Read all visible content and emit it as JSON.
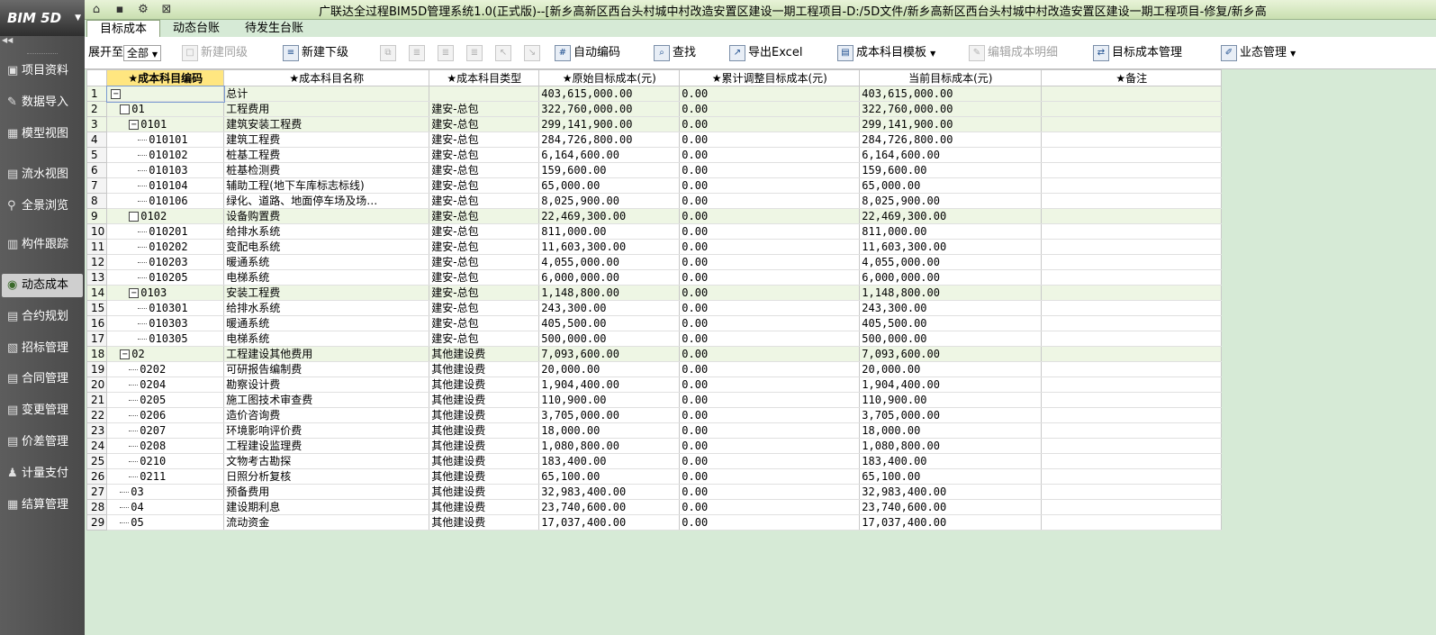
{
  "app": {
    "logo": "BIM 5D",
    "title": "广联达全过程BIM5D管理系统1.0(正式版)--[新乡高新区西台头村城中村改造安置区建设一期工程项目-D:/5D文件/新乡高新区西台头村城中村改造安置区建设一期工程项目-修复/新乡高"
  },
  "tabs": [
    {
      "label": "目标成本",
      "active": true
    },
    {
      "label": "动态台账",
      "active": false
    },
    {
      "label": "待发生台账",
      "active": false
    }
  ],
  "sidebar": {
    "items": [
      {
        "icon": "folder-icon",
        "label": "项目资料"
      },
      {
        "icon": "import-icon",
        "label": "数据导入"
      },
      {
        "icon": "model-icon",
        "label": "模型视图"
      },
      {
        "icon": "flow-icon",
        "label": "流水视图"
      },
      {
        "icon": "panorama-icon",
        "label": "全景浏览"
      },
      {
        "icon": "tracking-icon",
        "label": "构件跟踪"
      },
      {
        "icon": "cost-icon",
        "label": "动态成本",
        "active": true
      },
      {
        "icon": "contract-plan-icon",
        "label": "合约规划"
      },
      {
        "icon": "bid-icon",
        "label": "招标管理"
      },
      {
        "icon": "contract-icon",
        "label": "合同管理"
      },
      {
        "icon": "change-icon",
        "label": "变更管理"
      },
      {
        "icon": "price-diff-icon",
        "label": "价差管理"
      },
      {
        "icon": "payment-icon",
        "label": "计量支付"
      },
      {
        "icon": "settlement-icon",
        "label": "结算管理"
      }
    ]
  },
  "toolbar": {
    "expand_label": "展开至",
    "expand_value": "全部",
    "new_same": "新建同级",
    "new_child": "新建下级",
    "auto_code": "自动编码",
    "find": "查找",
    "export_excel": "导出Excel",
    "subject_template": "成本科目模板",
    "edit_detail": "编辑成本明细",
    "target_manage": "目标成本管理",
    "business_manage": "业态管理"
  },
  "grid": {
    "headers": [
      "★成本科目编码",
      "★成本科目名称",
      "★成本科目类型",
      "★原始目标成本(元)",
      "★累计调整目标成本(元)",
      "当前目标成本(元)",
      "★备注"
    ],
    "rows": [
      {
        "n": "1",
        "code": "",
        "name": "总计",
        "type": "",
        "orig": "403,615,000.00",
        "adj": "0.00",
        "cur": "403,615,000.00",
        "lvl": 0,
        "box": "−",
        "grp": true
      },
      {
        "n": "2",
        "code": "01",
        "name": "工程费用",
        "type": "建安-总包",
        "orig": "322,760,000.00",
        "adj": "0.00",
        "cur": "322,760,000.00",
        "lvl": 1,
        "box": " ",
        "grp": true
      },
      {
        "n": "3",
        "code": "0101",
        "name": "建筑安装工程费",
        "type": "建安-总包",
        "orig": "299,141,900.00",
        "adj": "0.00",
        "cur": "299,141,900.00",
        "lvl": 2,
        "box": "−",
        "grp": true
      },
      {
        "n": "4",
        "code": "010101",
        "name": "建筑工程费",
        "type": "建安-总包",
        "orig": "284,726,800.00",
        "adj": "0.00",
        "cur": "284,726,800.00",
        "lvl": 3
      },
      {
        "n": "5",
        "code": "010102",
        "name": "桩基工程费",
        "type": "建安-总包",
        "orig": "6,164,600.00",
        "adj": "0.00",
        "cur": "6,164,600.00",
        "lvl": 3
      },
      {
        "n": "6",
        "code": "010103",
        "name": "桩基检测费",
        "type": "建安-总包",
        "orig": "159,600.00",
        "adj": "0.00",
        "cur": "159,600.00",
        "lvl": 3
      },
      {
        "n": "7",
        "code": "010104",
        "name": "辅助工程(地下车库标志标线)",
        "type": "建安-总包",
        "orig": "65,000.00",
        "adj": "0.00",
        "cur": "65,000.00",
        "lvl": 3
      },
      {
        "n": "8",
        "code": "010106",
        "name": "绿化、道路、地面停车场及场…",
        "type": "建安-总包",
        "orig": "8,025,900.00",
        "adj": "0.00",
        "cur": "8,025,900.00",
        "lvl": 3
      },
      {
        "n": "9",
        "code": "0102",
        "name": "设备购置费",
        "type": "建安-总包",
        "orig": "22,469,300.00",
        "adj": "0.00",
        "cur": "22,469,300.00",
        "lvl": 2,
        "box": " ",
        "grp": true
      },
      {
        "n": "10",
        "code": "010201",
        "name": "给排水系统",
        "type": "建安-总包",
        "orig": "811,000.00",
        "adj": "0.00",
        "cur": "811,000.00",
        "lvl": 3
      },
      {
        "n": "11",
        "code": "010202",
        "name": "变配电系统",
        "type": "建安-总包",
        "orig": "11,603,300.00",
        "adj": "0.00",
        "cur": "11,603,300.00",
        "lvl": 3
      },
      {
        "n": "12",
        "code": "010203",
        "name": "暖通系统",
        "type": "建安-总包",
        "orig": "4,055,000.00",
        "adj": "0.00",
        "cur": "4,055,000.00",
        "lvl": 3
      },
      {
        "n": "13",
        "code": "010205",
        "name": "电梯系统",
        "type": "建安-总包",
        "orig": "6,000,000.00",
        "adj": "0.00",
        "cur": "6,000,000.00",
        "lvl": 3
      },
      {
        "n": "14",
        "code": "0103",
        "name": "安装工程费",
        "type": "建安-总包",
        "orig": "1,148,800.00",
        "adj": "0.00",
        "cur": "1,148,800.00",
        "lvl": 2,
        "box": "−",
        "grp": true
      },
      {
        "n": "15",
        "code": "010301",
        "name": "给排水系统",
        "type": "建安-总包",
        "orig": "243,300.00",
        "adj": "0.00",
        "cur": "243,300.00",
        "lvl": 3
      },
      {
        "n": "16",
        "code": "010303",
        "name": "暖通系统",
        "type": "建安-总包",
        "orig": "405,500.00",
        "adj": "0.00",
        "cur": "405,500.00",
        "lvl": 3
      },
      {
        "n": "17",
        "code": "010305",
        "name": "电梯系统",
        "type": "建安-总包",
        "orig": "500,000.00",
        "adj": "0.00",
        "cur": "500,000.00",
        "lvl": 3
      },
      {
        "n": "18",
        "code": "02",
        "name": "工程建设其他费用",
        "type": "其他建设费",
        "orig": "7,093,600.00",
        "adj": "0.00",
        "cur": "7,093,600.00",
        "lvl": 1,
        "box": "−",
        "grp": true
      },
      {
        "n": "19",
        "code": "0202",
        "name": "可研报告编制费",
        "type": "其他建设费",
        "orig": "20,000.00",
        "adj": "0.00",
        "cur": "20,000.00",
        "lvl": 2
      },
      {
        "n": "20",
        "code": "0204",
        "name": "勘察设计费",
        "type": "其他建设费",
        "orig": "1,904,400.00",
        "adj": "0.00",
        "cur": "1,904,400.00",
        "lvl": 2
      },
      {
        "n": "21",
        "code": "0205",
        "name": "施工图技术审查费",
        "type": "其他建设费",
        "orig": "110,900.00",
        "adj": "0.00",
        "cur": "110,900.00",
        "lvl": 2
      },
      {
        "n": "22",
        "code": "0206",
        "name": "造价咨询费",
        "type": "其他建设费",
        "orig": "3,705,000.00",
        "adj": "0.00",
        "cur": "3,705,000.00",
        "lvl": 2
      },
      {
        "n": "23",
        "code": "0207",
        "name": "环境影响评价费",
        "type": "其他建设费",
        "orig": "18,000.00",
        "adj": "0.00",
        "cur": "18,000.00",
        "lvl": 2
      },
      {
        "n": "24",
        "code": "0208",
        "name": "工程建设监理费",
        "type": "其他建设费",
        "orig": "1,080,800.00",
        "adj": "0.00",
        "cur": "1,080,800.00",
        "lvl": 2
      },
      {
        "n": "25",
        "code": "0210",
        "name": "文物考古勘探",
        "type": "其他建设费",
        "orig": "183,400.00",
        "adj": "0.00",
        "cur": "183,400.00",
        "lvl": 2
      },
      {
        "n": "26",
        "code": "0211",
        "name": "日照分析复核",
        "type": "其他建设费",
        "orig": "65,100.00",
        "adj": "0.00",
        "cur": "65,100.00",
        "lvl": 2
      },
      {
        "n": "27",
        "code": "03",
        "name": "预备费用",
        "type": "其他建设费",
        "orig": "32,983,400.00",
        "adj": "0.00",
        "cur": "32,983,400.00",
        "lvl": 1
      },
      {
        "n": "28",
        "code": "04",
        "name": "建设期利息",
        "type": "其他建设费",
        "orig": "23,740,600.00",
        "adj": "0.00",
        "cur": "23,740,600.00",
        "lvl": 1
      },
      {
        "n": "29",
        "code": "05",
        "name": "流动资金",
        "type": "其他建设费",
        "orig": "17,037,400.00",
        "adj": "0.00",
        "cur": "17,037,400.00",
        "lvl": 1
      }
    ]
  }
}
